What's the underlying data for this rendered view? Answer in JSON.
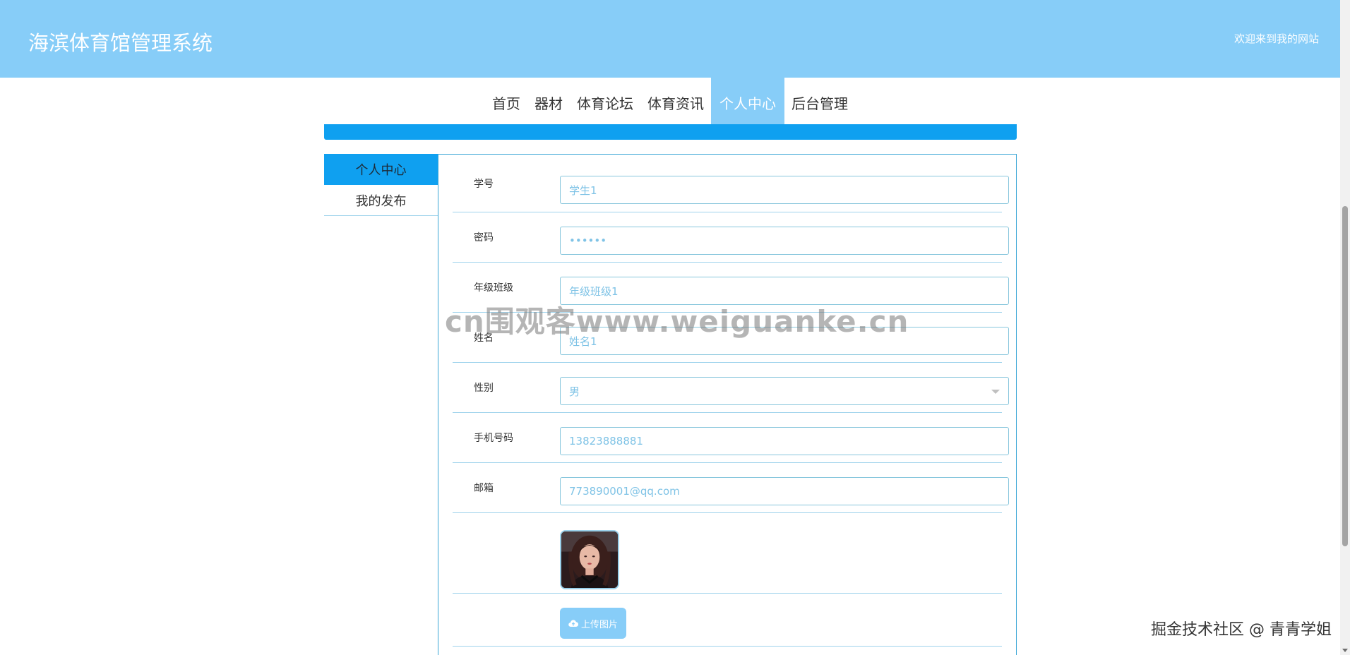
{
  "header": {
    "title": "海滨体育馆管理系统",
    "welcome": "欢迎来到我的网站"
  },
  "nav": {
    "items": [
      {
        "label": "首页",
        "active": false
      },
      {
        "label": "器材",
        "active": false
      },
      {
        "label": "体育论坛",
        "active": false
      },
      {
        "label": "体育资讯",
        "active": false
      },
      {
        "label": "个人中心",
        "active": true
      },
      {
        "label": "后台管理",
        "active": false
      }
    ]
  },
  "sidebar": {
    "items": [
      {
        "label": "个人中心",
        "active": true
      },
      {
        "label": "我的发布",
        "active": false
      }
    ]
  },
  "form": {
    "student_id": {
      "label": "学号",
      "value": "学生1"
    },
    "password": {
      "label": "密码",
      "value": "••••••"
    },
    "grade_class": {
      "label": "年级班级",
      "value": "年级班级1"
    },
    "name": {
      "label": "姓名",
      "value": "姓名1"
    },
    "gender": {
      "label": "性别",
      "value": "男"
    },
    "phone": {
      "label": "手机号码",
      "value": "13823888881"
    },
    "email": {
      "label": "邮箱",
      "value": "773890001@qq.com"
    },
    "upload_label": "上传图片"
  },
  "watermarks": {
    "center": "cn围观客www.weiguanke.cn",
    "corner": "掘金技术社区 @ 青青学姐"
  },
  "colors": {
    "header_bg": "#87cdf8",
    "accent_blue": "#0fa0f0",
    "field_border": "#87c6dc",
    "field_text": "#7fc3e6"
  },
  "icons": {
    "upload": "cloud-upload-icon",
    "select_caret": "caret-down-icon"
  }
}
